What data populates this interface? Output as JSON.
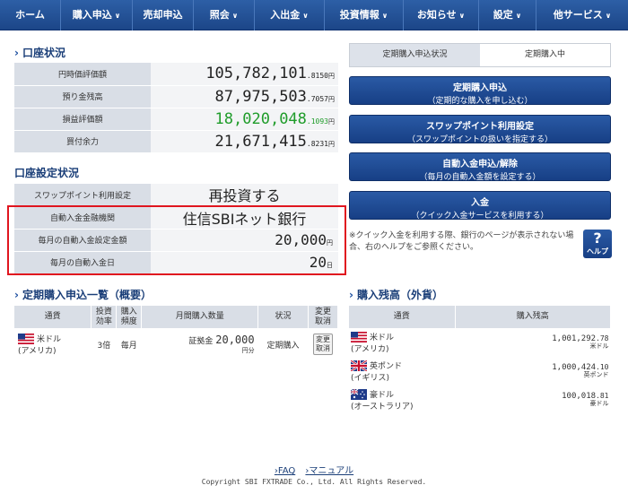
{
  "nav": {
    "items": [
      {
        "label": "ホーム",
        "chevron": false
      },
      {
        "label": "購入申込",
        "chevron": true
      },
      {
        "label": "売却申込",
        "chevron": false
      },
      {
        "label": "照会",
        "chevron": true
      },
      {
        "label": "入出金",
        "chevron": true
      },
      {
        "label": "投資情報",
        "chevron": true
      },
      {
        "label": "お知らせ",
        "chevron": true
      },
      {
        "label": "設定",
        "chevron": true
      },
      {
        "label": "他サービス",
        "chevron": true
      }
    ]
  },
  "account": {
    "title": "口座状況",
    "rows": [
      {
        "label": "円時価評価額",
        "int": "105,782,101",
        "dec": ".8150",
        "unit": "円",
        "color": "#222222"
      },
      {
        "label": "預り金残高",
        "int": "87,975,503",
        "dec": ".7057",
        "unit": "円",
        "color": "#222222"
      },
      {
        "label": "損益評価額",
        "int": "18,020,048",
        "dec": ".1093",
        "unit": "円",
        "color": "#1f9c2a"
      },
      {
        "label": "買付余力",
        "int": "21,671,415",
        "dec": ".8231",
        "unit": "円",
        "color": "#222222"
      }
    ]
  },
  "settings": {
    "title": "口座設定状況",
    "swap_label": "スワップポイント利用設定",
    "swap_value": "再投資する",
    "bank_label": "自動入金金融機関",
    "bank_value": "住信SBIネット銀行",
    "amount_label": "毎月の自動入金設定金額",
    "amount_value": "20,000",
    "amount_unit": "円",
    "day_label": "毎月の自動入金日",
    "day_value": "20",
    "day_unit": "日"
  },
  "tabs": {
    "inactive": "定期購入申込状況",
    "active": "定期購入中"
  },
  "buttons": [
    {
      "title": "定期購入申込",
      "sub": "（定期的な購入を申し込む）"
    },
    {
      "title": "スワップポイント利用設定",
      "sub": "（スワップポイントの扱いを指定する）"
    },
    {
      "title": "自動入金申込/解除",
      "sub": "（毎月の自動入金額を設定する）"
    },
    {
      "title": "入金",
      "sub": "（クイック入金サービスを利用する）"
    }
  ],
  "note": "※クイック入金を利用する際、銀行のページが表示されない場合、右のヘルプをご参照ください。",
  "help": {
    "q": "?",
    "label": "ヘルプ"
  },
  "periodic": {
    "title": "定期購入申込一覧（概要）",
    "headers": [
      "通貨",
      "投資\n効率",
      "購入\n頻度",
      "月間購入数量",
      "状況",
      "変更\n取消"
    ],
    "row": {
      "currency": "米ドル",
      "country": "(アメリカ)",
      "efficiency": "3倍",
      "frequency": "毎月",
      "qty_prefix": "証拠金",
      "qty": "20,000",
      "qty_unit": "円分",
      "status": "定期購入",
      "action": "変更\n取消"
    }
  },
  "balance": {
    "title": "購入残高（外貨）",
    "headers": [
      "通貨",
      "購入残高"
    ],
    "rows": [
      {
        "currency": "米ドル",
        "country": "(アメリカ)",
        "int": "1,001,292",
        "dec": ".78",
        "unit": "米ドル",
        "flag": "us"
      },
      {
        "currency": "英ポンド",
        "country": "(イギリス)",
        "int": "1,000,424",
        "dec": ".10",
        "unit": "英ポンド",
        "flag": "uk"
      },
      {
        "currency": "豪ドル",
        "country": "(オーストラリア)",
        "int": "100,018",
        "dec": ".81",
        "unit": "豪ドル",
        "flag": "au"
      }
    ]
  },
  "footer": {
    "faq": "FAQ",
    "manual": "マニュアル",
    "copyright": "Copyright SBI FXTRADE Co., Ltd. All Rights Reserved."
  }
}
